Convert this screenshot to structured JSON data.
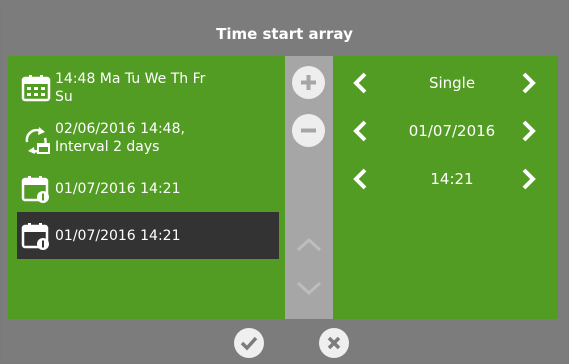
{
  "title": "Time start array",
  "list": {
    "items": [
      {
        "line1": "14:48 Ma Tu We Th Fr",
        "line2": "Su",
        "icon": "weekly-calendar-icon",
        "selected": false
      },
      {
        "line1": "02/06/2016 14:48,",
        "line2": "Interval 2 days",
        "icon": "interval-repeat-icon",
        "selected": false
      },
      {
        "line1": "01/07/2016 14:21",
        "line2": "",
        "icon": "single-date-calendar-icon",
        "selected": false
      },
      {
        "line1": "01/07/2016 14:21",
        "line2": "",
        "icon": "single-date-calendar-icon",
        "selected": true
      }
    ]
  },
  "settings": {
    "mode": "Single",
    "date": "01/07/2016",
    "time": "14:21"
  },
  "colors": {
    "panel_green": "#529c23",
    "frame_gray": "#7c7c7c",
    "mid_gray": "#a6a6a6",
    "selected_bg": "#333333"
  }
}
